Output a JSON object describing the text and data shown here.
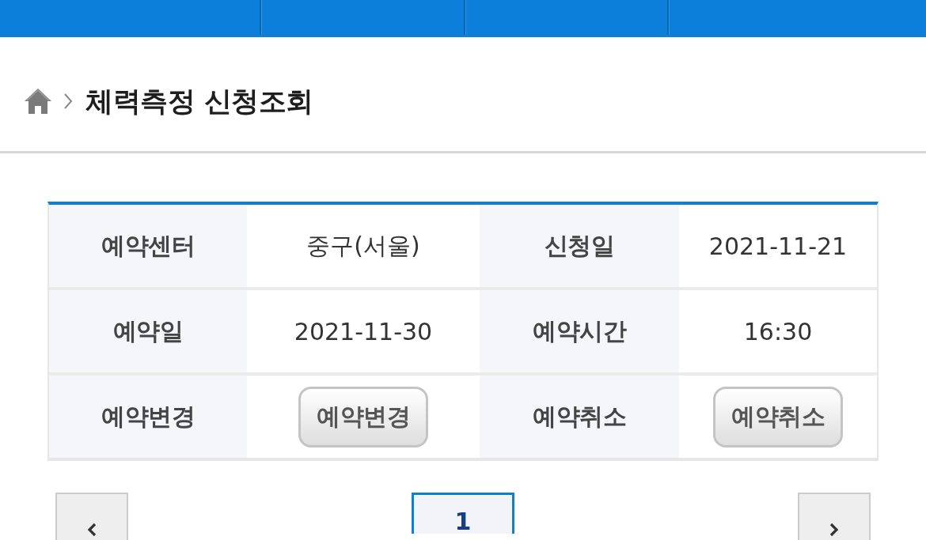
{
  "breadcrumb": {
    "title": "체력측정 신청조회"
  },
  "table": {
    "rows": [
      [
        {
          "kind": "label",
          "text": "예약센터"
        },
        {
          "kind": "value",
          "text": "중구(서울)"
        },
        {
          "kind": "label",
          "text": "신청일"
        },
        {
          "kind": "value",
          "text": "2021-11-21"
        }
      ],
      [
        {
          "kind": "label",
          "text": "예약일"
        },
        {
          "kind": "value",
          "text": "2021-11-30"
        },
        {
          "kind": "label",
          "text": "예약시간"
        },
        {
          "kind": "value",
          "text": "16:30"
        }
      ],
      [
        {
          "kind": "label",
          "text": "예약변경"
        },
        {
          "kind": "button",
          "text": "예약변경"
        },
        {
          "kind": "label",
          "text": "예약취소"
        },
        {
          "kind": "button",
          "text": "예약취소"
        }
      ]
    ]
  },
  "pagination": {
    "pages": [
      {
        "label": "1",
        "selected": true
      }
    ]
  }
}
